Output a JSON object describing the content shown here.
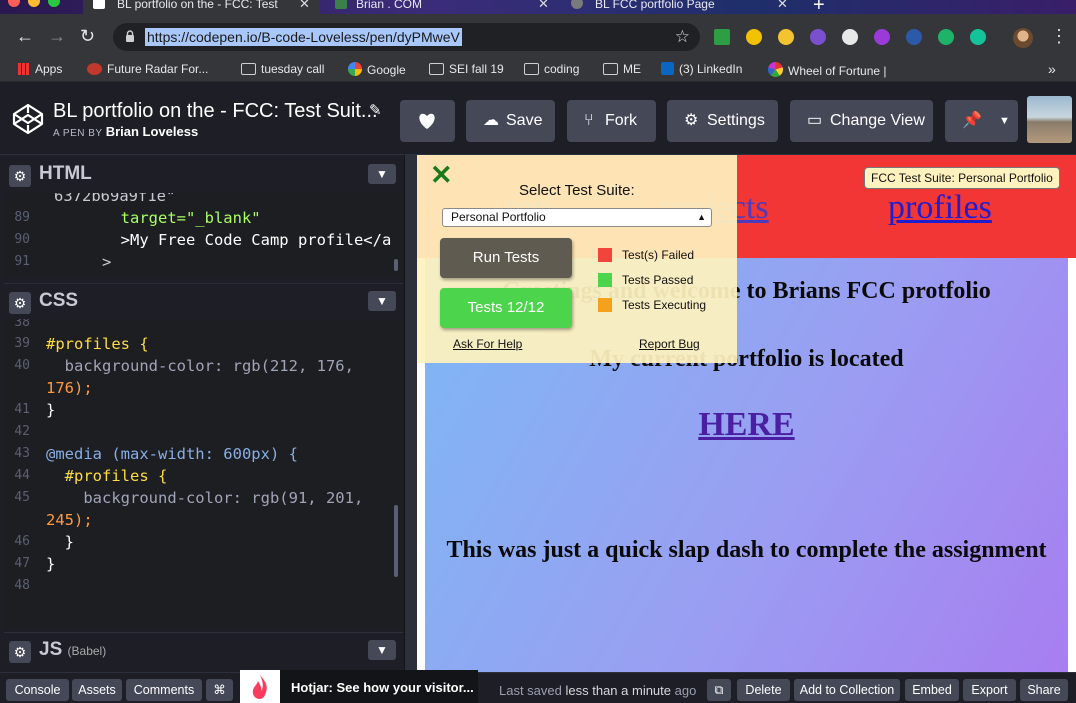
{
  "browser": {
    "tabs": [
      {
        "title": "BL portfolio on the - FCC: Test"
      },
      {
        "title": "Brian . COM"
      },
      {
        "title": "BL FCC portfolio Page"
      }
    ],
    "url": "https://codepen.io/B-code-Loveless/pen/dyPMweV",
    "bookmarks": [
      {
        "label": "Apps",
        "icon": "apps-grid-icon"
      },
      {
        "label": "Future Radar For...",
        "icon": "radar-icon"
      },
      {
        "label": "tuesday call",
        "icon": "folder-icon"
      },
      {
        "label": "Google",
        "icon": "google-icon"
      },
      {
        "label": "SEI fall 19",
        "icon": "folder-icon"
      },
      {
        "label": "coding",
        "icon": "folder-icon"
      },
      {
        "label": "ME",
        "icon": "folder-icon"
      },
      {
        "label": "(3) LinkedIn",
        "icon": "linkedin-icon"
      },
      {
        "label": "Wheel of Fortune |",
        "icon": "wheel-icon"
      }
    ],
    "more_bookmarks": "»"
  },
  "pen": {
    "title": "BL portfolio on the - FCC: Test Suit...",
    "by_prefix": "A PEN BY",
    "author": "Brian Loveless",
    "buttons": {
      "save": "Save",
      "fork": "Fork",
      "settings": "Settings",
      "change_view": "Change View"
    }
  },
  "editor": {
    "html": {
      "title": "HTML",
      "lines": [
        {
          "n": "",
          "text": "6372b69a9f1e\""
        },
        {
          "n": "89",
          "text": "        target=\"_blank\""
        },
        {
          "n": "90",
          "text": "        >My Free Code Camp profile</a"
        },
        {
          "n": "91",
          "text": "      >"
        }
      ]
    },
    "css": {
      "title": "CSS",
      "lines": [
        {
          "n": "38",
          "text": ""
        },
        {
          "n": "39",
          "text": "#profiles {"
        },
        {
          "n": "40",
          "text": "  background-color: rgb(212, 176,"
        },
        {
          "n": "",
          "text": "176);"
        },
        {
          "n": "41",
          "text": "}"
        },
        {
          "n": "42",
          "text": ""
        },
        {
          "n": "43",
          "text": "@media (max-width: 600px) {"
        },
        {
          "n": "44",
          "text": "  #profiles {"
        },
        {
          "n": "45",
          "text": "    background-color: rgb(91, 201,"
        },
        {
          "n": "",
          "text": "245);"
        },
        {
          "n": "46",
          "text": "  }"
        },
        {
          "n": "47",
          "text": "}"
        },
        {
          "n": "48",
          "text": ""
        }
      ]
    },
    "js": {
      "title": "JS",
      "sub": "(Babel)"
    }
  },
  "preview": {
    "nav": [
      "projects",
      "profiles"
    ],
    "nav_hidden": "top",
    "welcome": "Greetings and welcome to Brians FCC protfolio",
    "located": "My current portfolio is located",
    "here": "HERE",
    "note": "This was just a quick slap dash to complete the assignment"
  },
  "fcc": {
    "close": "✕",
    "select_label": "Select Test Suite:",
    "selected_suite": "Personal Portfolio",
    "run_tests": "Run Tests",
    "tests_result": "Tests 12/12",
    "legend": [
      {
        "label": "Test(s) Failed",
        "color": "#f0453a"
      },
      {
        "label": "Tests Passed",
        "color": "#4cd44c"
      },
      {
        "label": "Tests Executing",
        "color": "#f5a11b"
      }
    ],
    "ask_help": "Ask For Help",
    "report_bug": "Report Bug",
    "badge": "FCC Test Suite: Personal Portfolio"
  },
  "footer": {
    "console": "Console",
    "assets": "Assets",
    "comments": "Comments",
    "shortcut": "⌘",
    "hotjar": "Hotjar: See how your visitor...",
    "saved_prefix": "Last saved",
    "saved_time": "less than a minute",
    "saved_suffix": "ago",
    "delete": "Delete",
    "add_collection": "Add to Collection",
    "embed": "Embed",
    "export": "Export",
    "share": "Share"
  },
  "colors": {
    "run_btn": "#5f5b50",
    "pass_btn": "#4cd44c",
    "nav_red": "#f23535"
  }
}
